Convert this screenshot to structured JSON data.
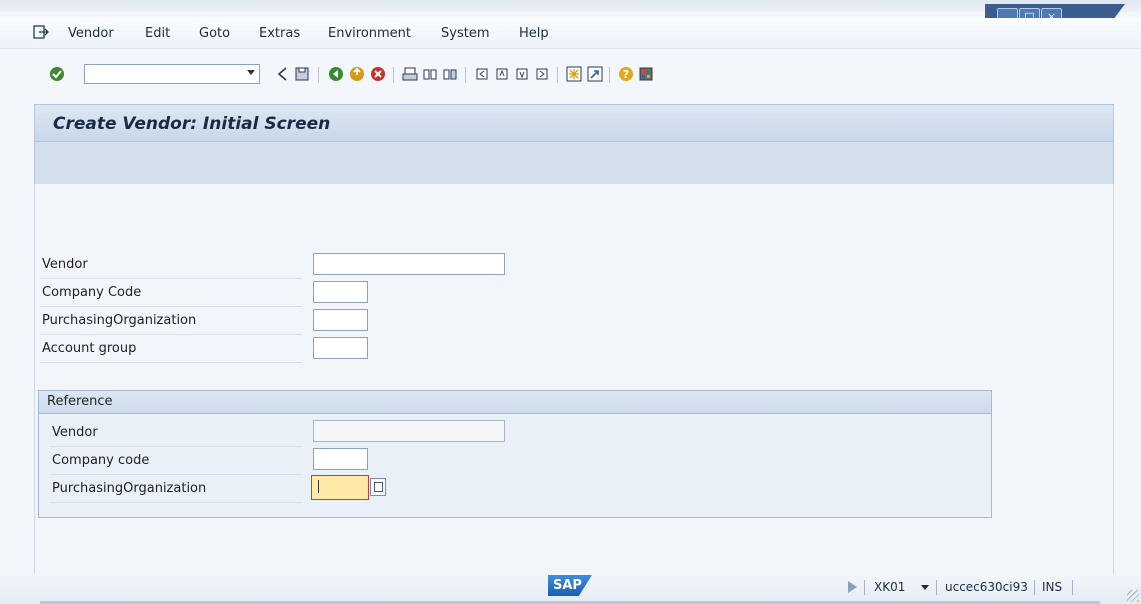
{
  "window": {
    "controls": {
      "minimize": "_",
      "maximize": "□",
      "close": "×"
    }
  },
  "menubar": {
    "items": [
      "Vendor",
      "Edit",
      "Goto",
      "Extras",
      "Environment",
      "System",
      "Help"
    ]
  },
  "toolbar": {
    "command_field_value": "",
    "icons": [
      "enter-icon",
      "back-arrow-icon",
      "save-icon",
      "back-icon",
      "exit-icon",
      "cancel-icon",
      "print-icon",
      "find-icon",
      "find-next-icon",
      "first-page-icon",
      "previous-page-icon",
      "next-page-icon",
      "last-page-icon",
      "create-session-icon",
      "generate-shortcut-icon",
      "help-icon",
      "layout-menu-icon"
    ]
  },
  "screen": {
    "title": "Create Vendor: Initial Screen"
  },
  "form": {
    "vendor_label": "Vendor",
    "vendor_value": "",
    "company_code_label": "Company Code",
    "company_code_value": "",
    "purch_org_label": "PurchasingOrganization",
    "purch_org_value": "",
    "account_group_label": "Account group",
    "account_group_value": ""
  },
  "reference": {
    "title": "Reference",
    "vendor_label": "Vendor",
    "vendor_value": "",
    "company_code_label": "Company code",
    "company_code_value": "",
    "purch_org_label": "PurchasingOrganization",
    "purch_org_value": ""
  },
  "statusbar": {
    "logo": "SAP",
    "transaction": "XK01",
    "server": "uccec630ci93",
    "mode": "INS"
  },
  "colors": {
    "title_bg": "#c8d7ea",
    "focus_field": "#ffe9a5",
    "focus_border": "#c73a3a",
    "sap_blue": "#1a5db4"
  }
}
